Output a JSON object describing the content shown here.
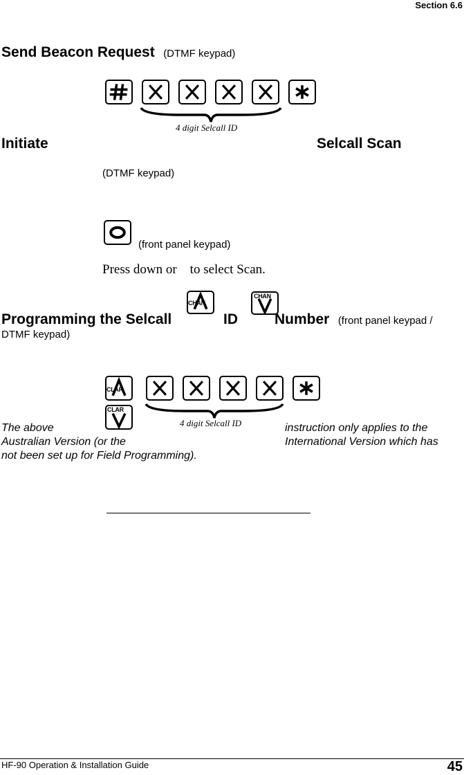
{
  "header": {
    "section": "Section 6.6"
  },
  "beacon": {
    "title": "Send Beacon Request",
    "subtitle": "(DTMF keypad)",
    "keys": [
      "hash-key",
      "x-key",
      "x-key",
      "x-key",
      "x-key",
      "star-key"
    ],
    "brace_label": "4 digit Selcall ID"
  },
  "scan": {
    "title_left": "Initiate",
    "title_right": "Selcall Scan",
    "dtmf_label": "(DTMF keypad)",
    "front_panel_label": "(front panel keypad)",
    "key": "o-key",
    "instruction": "Press down or    to select Scan."
  },
  "programming": {
    "title_a": "Programming the Selcall",
    "title_b": "ID",
    "title_c": "Number",
    "subtitle_a": "(front panel keypad /",
    "subtitle_b": "DTMF keypad)",
    "chan_up_label": "CHAN",
    "chan_down_label": "CHAN",
    "clar_up_label": "CLAR",
    "clar_down_label": "CLAR",
    "keys": [
      "x-key",
      "x-key",
      "x-key",
      "x-key",
      "star-key"
    ],
    "brace_label": "4 digit Selcall ID",
    "note_left": [
      "The above",
      "Australian Version (or the",
      "not been set up for Field Programming)."
    ],
    "note_right": [
      "instruction only applies to the",
      "International Version which has"
    ]
  },
  "footer": {
    "guide_title": "HF-90 Operation & Installation Guide",
    "page_number": "45"
  }
}
